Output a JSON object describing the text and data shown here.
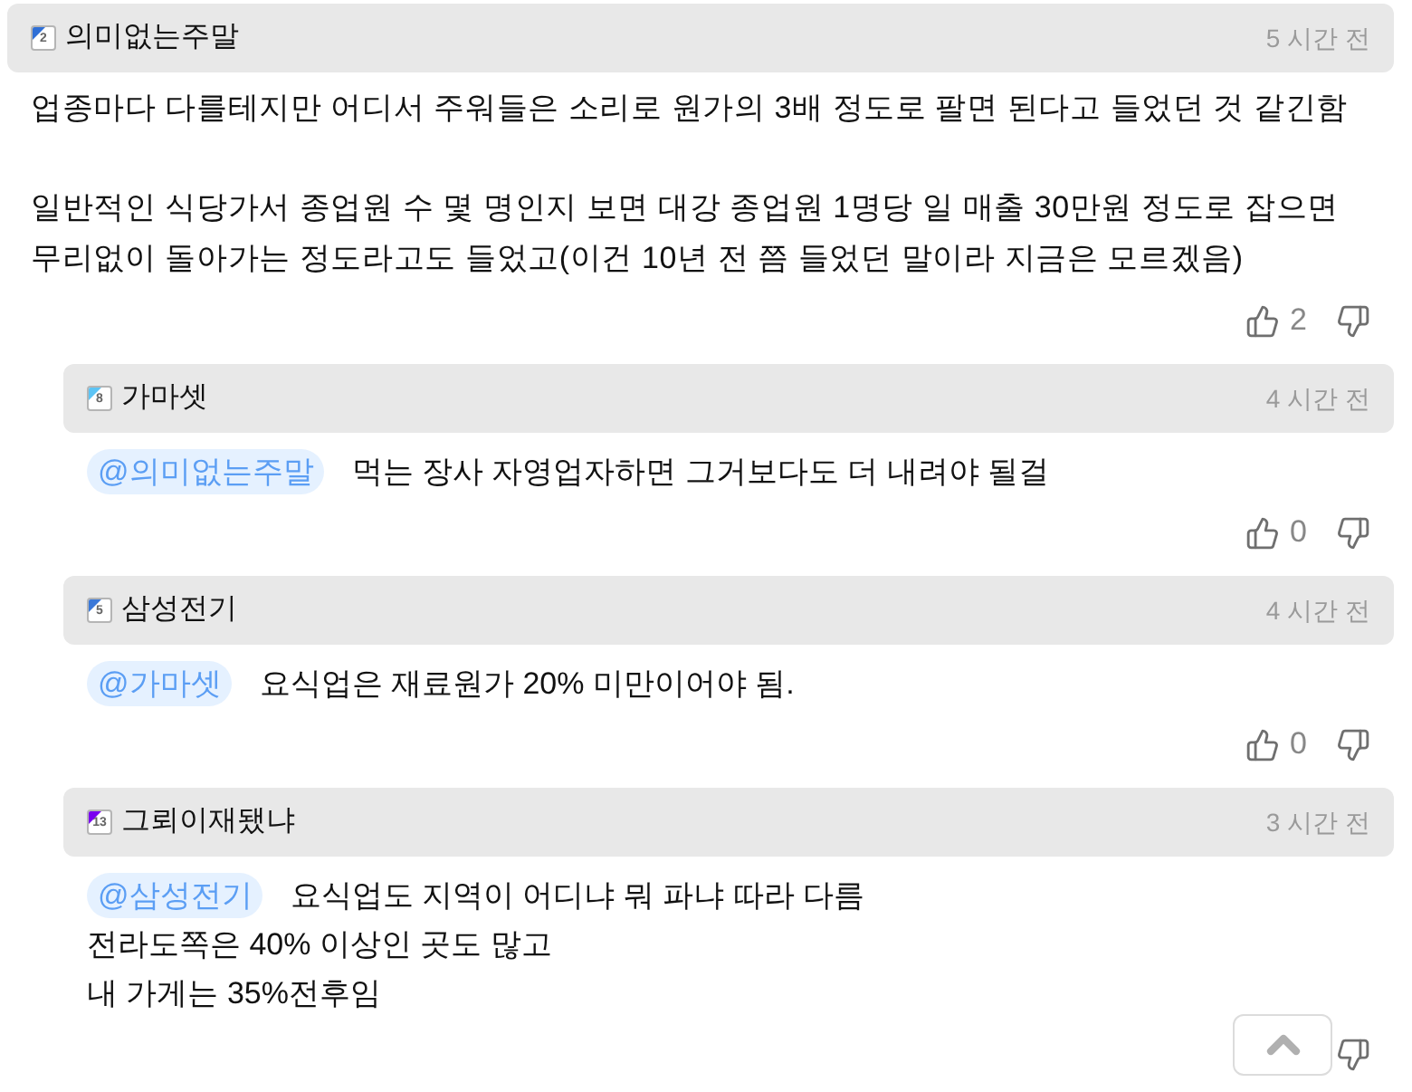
{
  "comments": [
    {
      "author": {
        "name": "의미없는주말",
        "badge": "2",
        "color": "#2f6fd6"
      },
      "time": "5 시간 전",
      "paragraphs": [
        "업종마다 다를테지만 어디서 주워들은 소리로 원가의 3배 정도로 팔면 된다고 들었던 것 같긴함",
        "일반적인 식당가서 종업원 수 몇 명인지 보면 대강 종업원 1명당 일 매출 30만원 정도로 잡으면\n무리없이 돌아가는 정도라고도 들었고(이건 10년 전 쯤 들었던 말이라 지금은 모르겠음)"
      ],
      "likes": "2",
      "replies": [
        {
          "author": {
            "name": "가마셋",
            "badge": "8",
            "color": "#5cc4f5"
          },
          "time": "4 시간 전",
          "mention": "@의미없는주말",
          "lines": [
            "먹는 장사 자영업자하면 그거보다도 더 내려야 될걸"
          ],
          "likes": "0"
        },
        {
          "author": {
            "name": "삼성전기",
            "badge": "5",
            "color": "#3a78d8"
          },
          "time": "4 시간 전",
          "mention": "@가마셋",
          "lines": [
            "요식업은 재료원가 20% 미만이어야 됨."
          ],
          "likes": "0"
        },
        {
          "author": {
            "name": "그뢰이재됐냐",
            "badge": "13",
            "color": "#7a00f0"
          },
          "time": "3 시간 전",
          "mention": "@삼성전기",
          "lines": [
            "요식업도 지역이 어디냐 뭐 파냐 따라 다름",
            "전라도쪽은 40% 이상인 곳도 많고",
            "내 가게는 35%전후임"
          ]
        }
      ]
    }
  ],
  "scroll_top_button": true
}
